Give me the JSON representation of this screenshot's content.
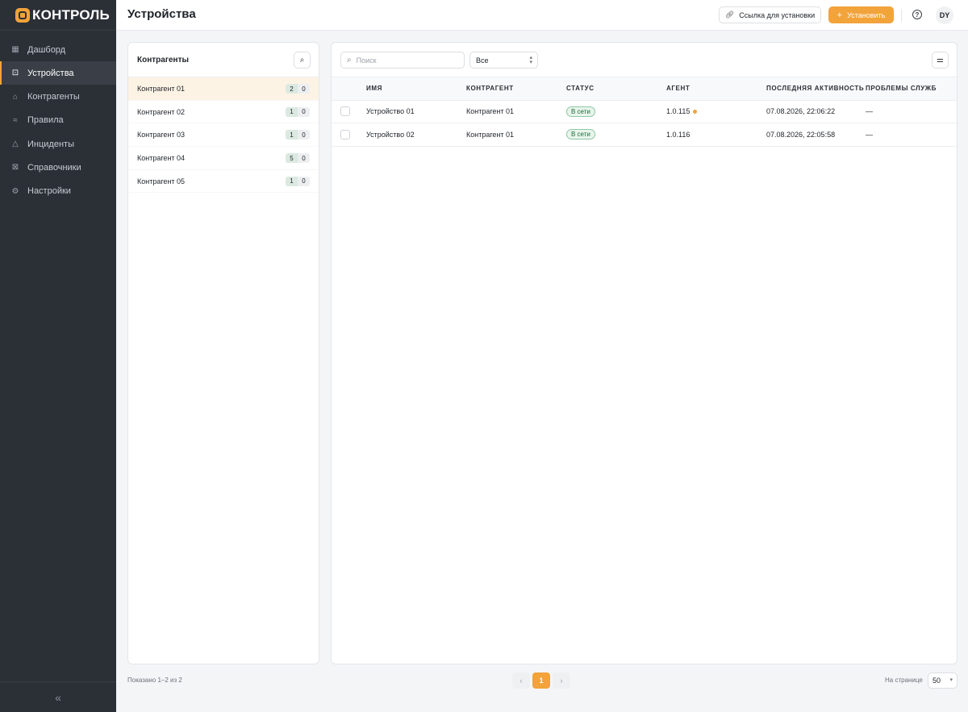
{
  "app": {
    "brand": "КОНТРОЛЬ",
    "accent": "#f2a33a"
  },
  "sidebar": {
    "items": [
      {
        "label": "Дашборд",
        "icon": "grid-icon"
      },
      {
        "label": "Устройства",
        "icon": "device-icon",
        "active": true
      },
      {
        "label": "Контрагенты",
        "icon": "building-icon"
      },
      {
        "label": "Правила",
        "icon": "sliders-icon"
      },
      {
        "label": "Инциденты",
        "icon": "warning-icon"
      },
      {
        "label": "Справочники",
        "icon": "book-icon"
      },
      {
        "label": "Настройки",
        "icon": "gear-icon"
      }
    ],
    "collapse_glyph": "«"
  },
  "header": {
    "title": "Устройства",
    "link_button": "Ссылка для установки",
    "install_button": "Установить",
    "help_glyph": "?",
    "avatar": "DY"
  },
  "clients": {
    "title": "Контрагенты",
    "items": [
      {
        "name": "Контрагент 01",
        "count": "2",
        "issues": "0",
        "selected": true
      },
      {
        "name": "Контрагент 02",
        "count": "1",
        "issues": "0"
      },
      {
        "name": "Контрагент 03",
        "count": "1",
        "issues": "0"
      },
      {
        "name": "Контрагент 04",
        "count": "5",
        "issues": "0"
      },
      {
        "name": "Контрагент 05",
        "count": "1",
        "issues": "0"
      }
    ]
  },
  "devices": {
    "search_placeholder": "Поиск",
    "filter_value": "Все",
    "columns": [
      "Имя",
      "Контрагент",
      "Статус",
      "Агент",
      "Последняя активность",
      "Проблемы служб"
    ],
    "rows": [
      {
        "name": "Устройство 01",
        "client": "Контрагент 01",
        "status": "В сети",
        "agent": "1.0.115",
        "agent_warning": true,
        "last_active": "07.08.2026, 22:06:22",
        "issues": "—"
      },
      {
        "name": "Устройство 02",
        "client": "Контрагент 01",
        "status": "В сети",
        "agent": "1.0.116",
        "agent_warning": false,
        "last_active": "07.08.2026, 22:05:58",
        "issues": "—"
      }
    ]
  },
  "footer": {
    "shown": "Показано 1–2 из 2",
    "current_page": "1",
    "per_page_label": "На странице",
    "per_page_value": "50"
  }
}
